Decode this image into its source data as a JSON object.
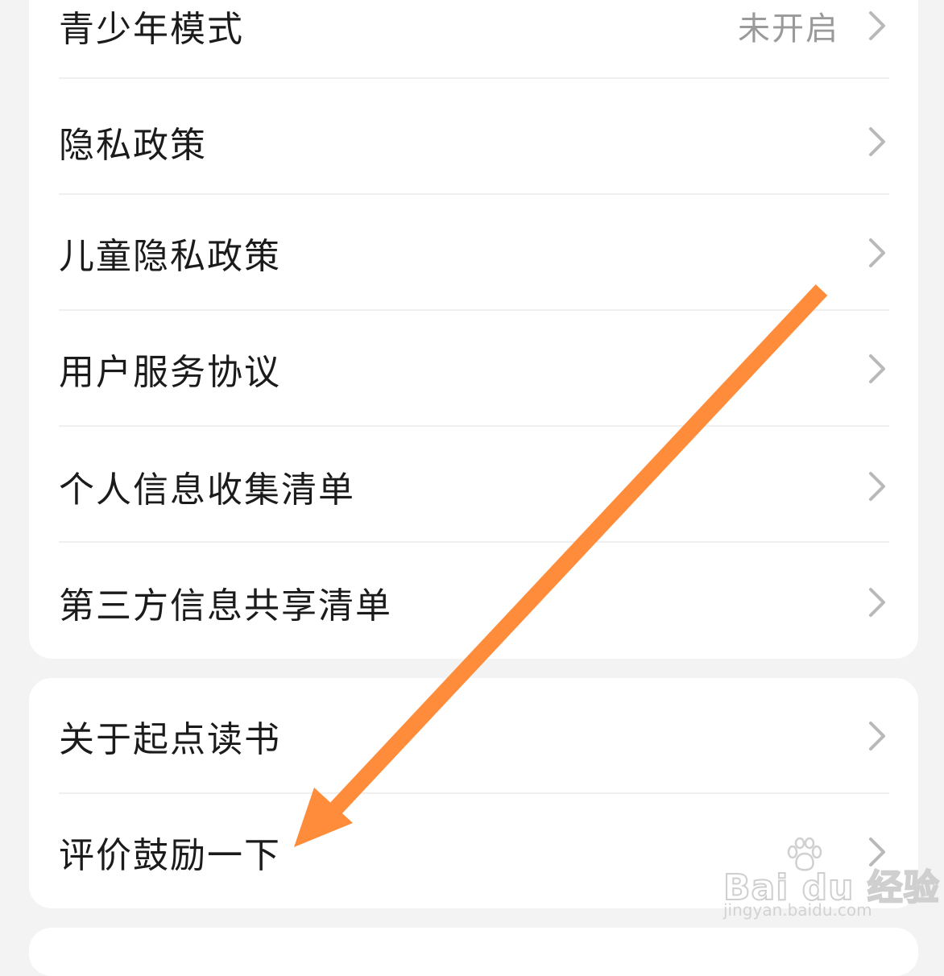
{
  "group1": {
    "items": [
      {
        "label": "青少年模式",
        "value": "未开启"
      },
      {
        "label": "隐私政策"
      },
      {
        "label": "儿童隐私政策"
      },
      {
        "label": "用户服务协议"
      },
      {
        "label": "个人信息收集清单"
      },
      {
        "label": "第三方信息共享清单"
      }
    ]
  },
  "group2": {
    "items": [
      {
        "label": "关于起点读书"
      },
      {
        "label": "评价鼓励一下"
      }
    ]
  },
  "annotation": {
    "arrow_color": "#ff8c3a"
  },
  "watermark": {
    "brand": "Bai du 经验",
    "url": "jingyan.baidu.com"
  },
  "icons": {
    "row_chevron": "chevron-right-icon"
  }
}
